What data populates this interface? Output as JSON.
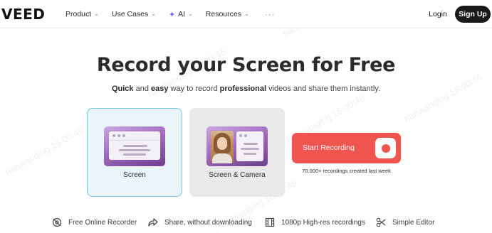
{
  "nav": {
    "logo": "VEED",
    "items": [
      {
        "label": "Product",
        "has_dropdown": true
      },
      {
        "label": "Use Cases",
        "has_dropdown": true
      },
      {
        "label": "AI",
        "has_dropdown": true,
        "icon": "sparkle-icon"
      },
      {
        "label": "Resources",
        "has_dropdown": true
      }
    ],
    "more": "···",
    "login": "Login",
    "signup": "Sign Up"
  },
  "hero": {
    "title": "Record your Screen for Free",
    "subtitle_parts": [
      "Quick",
      " and ",
      "easy",
      " way to record ",
      "professional",
      " videos and share them instantly."
    ]
  },
  "modes": [
    {
      "label": "Screen",
      "selected": true
    },
    {
      "label": "Screen & Camera",
      "selected": false
    }
  ],
  "record": {
    "button_label": "Start Recording",
    "count_text": "70.000+ recordings created last week"
  },
  "features": [
    {
      "icon": "no-recording-icon",
      "label": "Free Online Recorder"
    },
    {
      "icon": "share-arrow-icon",
      "label": "Share, without downloading"
    },
    {
      "icon": "film-strip-icon",
      "label": "1080p High-res recordings"
    },
    {
      "icon": "scissors-icon",
      "label": "Simple Editor"
    }
  ],
  "watermark": "hanwanqing 16:00:46",
  "colors": {
    "accent_red": "#f0544f",
    "selected_border": "#74c6e6",
    "selected_bg": "#eaf5fb",
    "ai_purple": "#7c5cff"
  }
}
